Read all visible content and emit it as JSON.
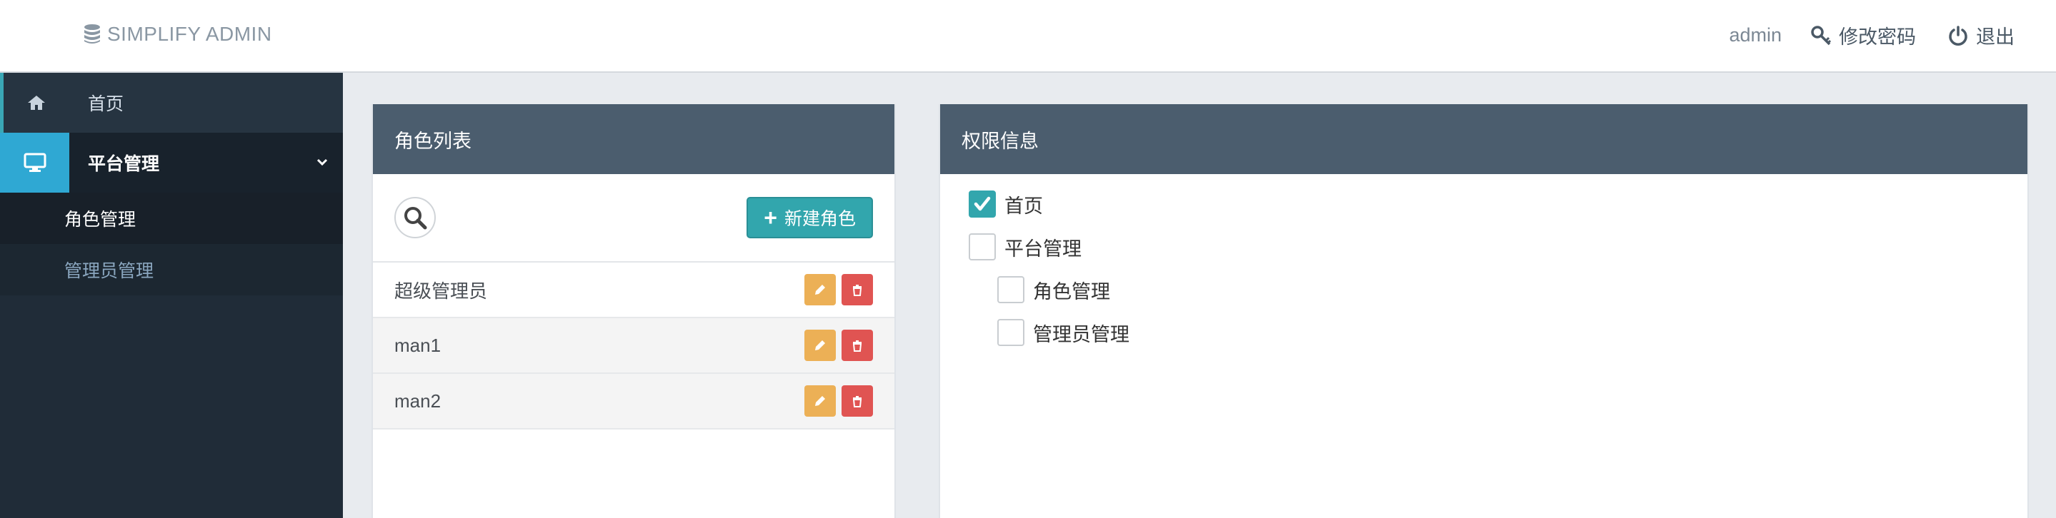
{
  "header": {
    "brand": "SIMPLIFY ADMIN",
    "user": "admin",
    "change_password": "修改密码",
    "logout": "退出"
  },
  "sidebar": {
    "items": [
      {
        "label": "首页",
        "icon": "home-icon"
      },
      {
        "label": "平台管理",
        "icon": "desktop-icon",
        "expanded": true
      }
    ],
    "sub_items": [
      {
        "label": "角色管理",
        "active": true
      },
      {
        "label": "管理员管理",
        "active": false
      }
    ]
  },
  "roles_panel": {
    "title": "角色列表",
    "new_button": "新建角色",
    "rows": [
      {
        "name": "超级管理员"
      },
      {
        "name": "man1"
      },
      {
        "name": "man2"
      }
    ]
  },
  "perm_panel": {
    "title": "权限信息",
    "tree": [
      {
        "label": "首页",
        "checked": true
      },
      {
        "label": "平台管理",
        "checked": false
      },
      {
        "label": "角色管理",
        "checked": false
      },
      {
        "label": "管理员管理",
        "checked": false
      }
    ]
  },
  "colors": {
    "accent": "#32a6ad",
    "sidebar_bg": "#202c38",
    "panel_header": "#4b5d6e",
    "edit_button": "#ecb056",
    "delete_button": "#e05452"
  }
}
